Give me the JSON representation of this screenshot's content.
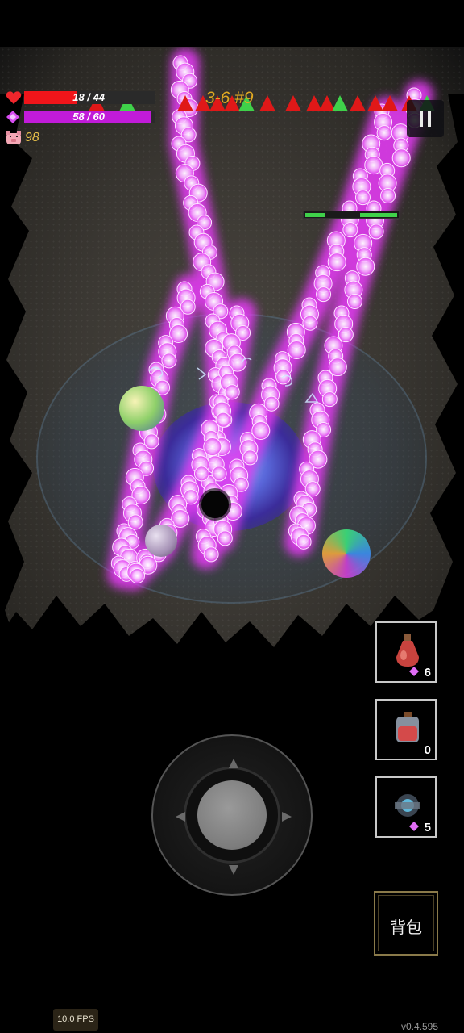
{
  "hud": {
    "hp_text": "18 / 44",
    "hp_fraction": 0.409,
    "mp_text": "58 / 60",
    "mp_fraction": 0.967,
    "coins": "98",
    "stage": "3-6 #9",
    "hp_icon": "heart-icon",
    "mp_icon": "diamond-icon",
    "coin_icon": "pig-icon"
  },
  "enemy": {
    "health_fraction": 0.58
  },
  "items": [
    {
      "name": "red-potion-icon",
      "count": "6",
      "cost_gem": true
    },
    {
      "name": "red-flask-icon",
      "count": "0",
      "cost_gem": false
    },
    {
      "name": "tech-orb-icon",
      "count": "5",
      "cost_gem": true
    }
  ],
  "bag_label": "背包",
  "fps": "10.0 FPS",
  "version": "v0.4.595",
  "colors": {
    "hp": "#f0151a",
    "mp": "#c11bd9",
    "coin_text": "#e7c04a",
    "stage_text": "#e0a822",
    "magic": "#e13bf0"
  }
}
